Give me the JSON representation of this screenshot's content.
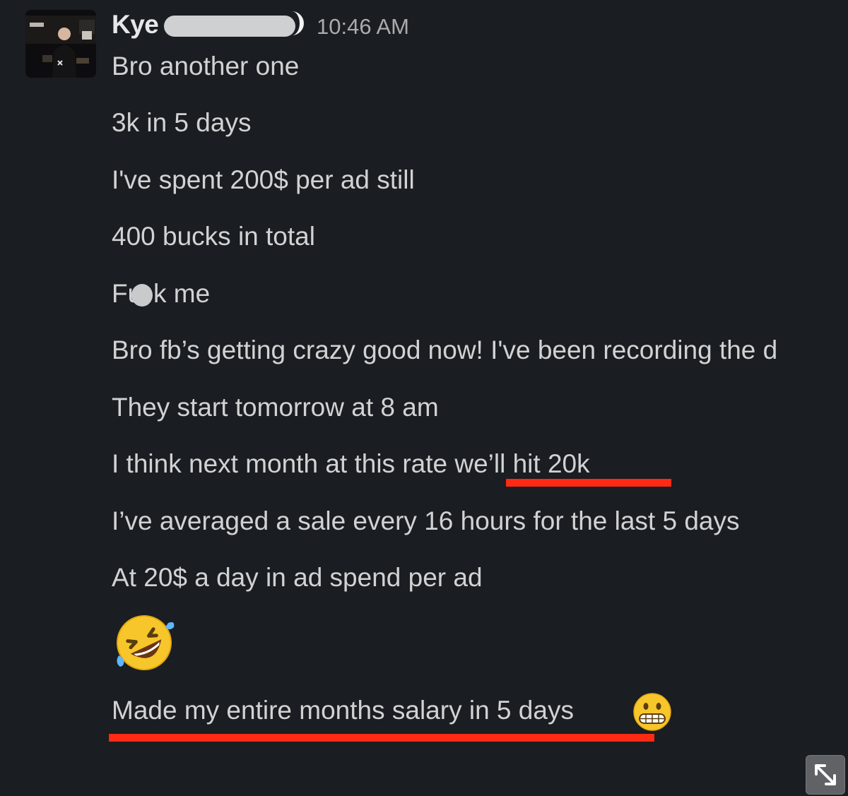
{
  "message": {
    "author": "Kye",
    "time": "10:46 AM",
    "lines": [
      "Bro another one",
      "3k in 5 days",
      "I've spent 200$ per ad still",
      "400 bucks in total",
      "Fu",
      "k me",
      "Bro fb’s getting crazy good now! I've been recording the d",
      "They start tomorrow at 8 am",
      "I think next month at this rate we’ll hit 20k",
      "I’ve averaged a sale every 16 hours for the last 5 days",
      "At 20$ a day in ad spend per ad",
      "Made my entire months salary in 5 days"
    ],
    "emoji_laugh": "rolling-on-floor-laughing-emoji",
    "emoji_grimace": "grimacing-face-emoji"
  },
  "colors": {
    "background": "#1a1d21",
    "text": "#d1d2d3",
    "author": "#e6e7e8",
    "timestamp": "#ababad",
    "highlight_underline": "#ff2a14"
  }
}
